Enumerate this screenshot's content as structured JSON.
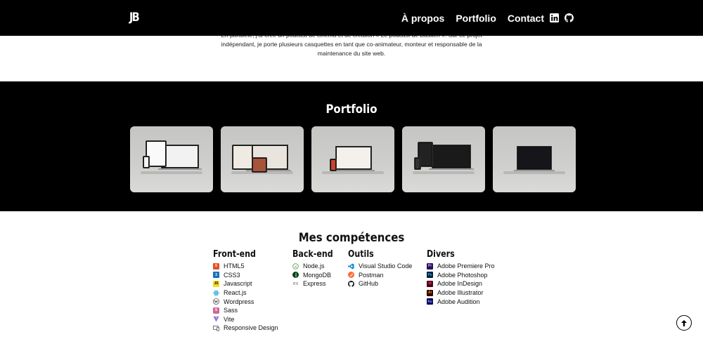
{
  "nav": {
    "logo": "JB",
    "links": [
      "À propos",
      "Portfolio",
      "Contact"
    ],
    "icons": [
      "linkedin-icon",
      "github-icon"
    ]
  },
  "about": {
    "line1": "En parallèle, j'ai créé un podcast de cinéma et de création « Le podcast de Bastien ». Sur ce projet",
    "line2": "indépendant, je porte plusieurs casquettes en tant que co-animateur, monteur et responsable de la",
    "line3": "maintenance du site web."
  },
  "portfolio": {
    "title": "Portfolio",
    "cards": [
      {
        "name": "project-1"
      },
      {
        "name": "project-2"
      },
      {
        "name": "project-3"
      },
      {
        "name": "project-4"
      },
      {
        "name": "project-5"
      }
    ]
  },
  "skills": {
    "title": "Mes compétences",
    "columns": [
      {
        "title": "Front-end",
        "items": [
          {
            "label": "HTML5",
            "icon": "html5-icon",
            "color": "#e34f26"
          },
          {
            "label": "CSS3",
            "icon": "css3-icon",
            "color": "#1572b6"
          },
          {
            "label": "Javascript",
            "icon": "javascript-icon",
            "color": "#f7df1e"
          },
          {
            "label": "React.js",
            "icon": "react-icon",
            "color": "#61dafb"
          },
          {
            "label": "Wordpress",
            "icon": "wordpress-icon",
            "color": "#21759b"
          },
          {
            "label": "Sass",
            "icon": "sass-icon",
            "color": "#cc6699"
          },
          {
            "label": "Vite",
            "icon": "vite-icon",
            "color": "#646cff"
          },
          {
            "label": "Responsive Design",
            "icon": "responsive-icon",
            "color": "#555555"
          }
        ]
      },
      {
        "title": "Back-end",
        "items": [
          {
            "label": "Node.js",
            "icon": "nodejs-icon",
            "color": "#539e43"
          },
          {
            "label": "MongoDB",
            "icon": "mongodb-icon",
            "color": "#1b4d2e"
          },
          {
            "label": "Express",
            "icon": "express-icon",
            "color": "#888888"
          }
        ]
      },
      {
        "title": "Outils",
        "items": [
          {
            "label": "Visual Studio Code",
            "icon": "vscode-icon",
            "color": "#007acc"
          },
          {
            "label": "Postman",
            "icon": "postman-icon",
            "color": "#ff6c37"
          },
          {
            "label": "GitHub",
            "icon": "github-icon",
            "color": "#181717"
          }
        ]
      },
      {
        "title": "Divers",
        "items": [
          {
            "label": "Adobe Premiere Pro",
            "icon": "premiere-icon",
            "color": "#2a0f5c",
            "abbr": "Pr"
          },
          {
            "label": "Adobe Photoshop",
            "icon": "photoshop-icon",
            "color": "#001e36",
            "abbr": "Ps"
          },
          {
            "label": "Adobe InDesign",
            "icon": "indesign-icon",
            "color": "#49021f",
            "abbr": "Id"
          },
          {
            "label": "Adobe Illustrator",
            "icon": "illustrator-icon",
            "color": "#330000",
            "abbr": "Ai"
          },
          {
            "label": "Adobe Audition",
            "icon": "audition-icon",
            "color": "#00005b",
            "abbr": "Au"
          }
        ]
      }
    ]
  },
  "scroll_top": {
    "icon": "arrow-up-icon"
  }
}
